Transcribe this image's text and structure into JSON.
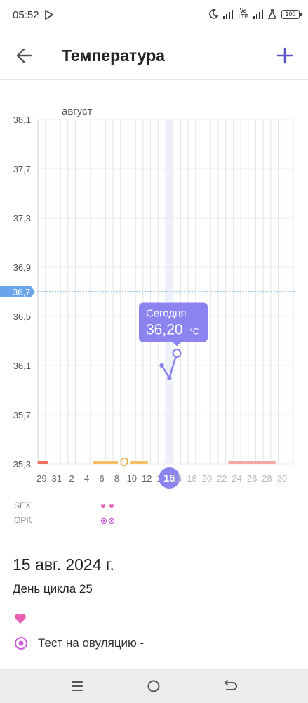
{
  "status_bar": {
    "time": "05:52",
    "volte_line1": "Vo",
    "volte_line2": "LTE",
    "battery": "100"
  },
  "app_bar": {
    "title": "Температура"
  },
  "chart_data": {
    "type": "line",
    "title": "",
    "month_label": "август",
    "y_ticks": [
      "38,1",
      "37,7",
      "37,3",
      "36,9",
      "36,5",
      "36,1",
      "35,7",
      "35,3"
    ],
    "ylim": [
      35.3,
      38.1
    ],
    "reference_line": {
      "label": "36,7",
      "value": 36.7
    },
    "x_ticks": [
      "29",
      "31",
      "2",
      "4",
      "6",
      "8",
      "10",
      "12",
      "14",
      "15",
      "16",
      "18",
      "20",
      "22",
      "24",
      "26",
      "28",
      "30"
    ],
    "selected_day": "15",
    "series": [
      {
        "points": [
          {
            "day_index": 16,
            "value": 36.1
          },
          {
            "day_index": 17,
            "value": 36.0
          },
          {
            "day_index": 18,
            "value": 36.2
          }
        ]
      }
    ],
    "tooltip": {
      "label": "Сегодня",
      "value": "36,20",
      "unit": "°C"
    },
    "colors": {
      "period": "#f0705f",
      "fertile": "#f7c063",
      "predicted_period": "#f5a9a9",
      "line": "#8b84f0",
      "reference": "#3d8fe8"
    }
  },
  "legend": {
    "sex_label": "SEX",
    "opk_label": "OPK"
  },
  "day_details": {
    "date": "15 авг. 2024 г.",
    "cycle_day": "День цикла 25",
    "ovulation_test": "Тест на овуляцию -"
  },
  "icons": {
    "back": "arrow-left-icon",
    "add": "plus-icon",
    "heart": "heart-icon",
    "ovulation": "target-icon"
  }
}
